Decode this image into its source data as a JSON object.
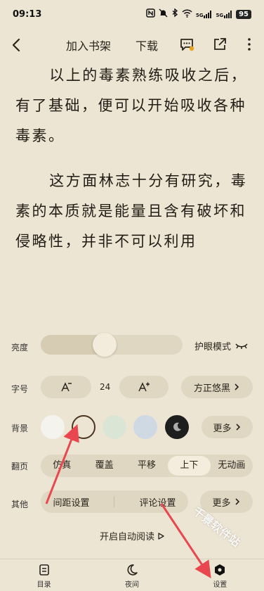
{
  "status_bar": {
    "time": "09:13",
    "signal_1": "5G",
    "signal_2": "5G",
    "battery": "95"
  },
  "toolbar": {
    "add_to_shelf": "加入书架",
    "download": "下载"
  },
  "reading": {
    "paragraphs": [
      "以上的毒素熟练吸收之后，有了基础，便可以开始吸收各种毒素。",
      "这方面林志十分有研究，毒素的本质就是能量且含有破坏和侵略性，并非不可以利用"
    ]
  },
  "settings": {
    "brightness_label": "亮度",
    "brightness_level": 0.45,
    "eye_care_label": "护眼模式",
    "font_size_label": "字号",
    "font_size_value": "24",
    "font_name": "方正悠黑",
    "background_label": "背景",
    "background_colors": [
      "#f5f3ee",
      "#ede5d3",
      "#dbe5d5",
      "#cfd9e3",
      "#1e1e1e"
    ],
    "background_more": "更多",
    "page_turn_label": "翻页",
    "page_turn_options": [
      "仿真",
      "覆盖",
      "平移",
      "上下",
      "无动画"
    ],
    "page_turn_selected": "上下",
    "other_label": "其他",
    "spacing_settings": "间距设置",
    "comment_settings": "评论设置",
    "other_more": "更多",
    "auto_read": "开启自动阅读"
  },
  "bottom_nav": {
    "items": [
      {
        "label": "目录"
      },
      {
        "label": "夜间"
      },
      {
        "label": "设置"
      }
    ]
  },
  "watermark": {
    "line_1": "千景软件站"
  },
  "colors": {
    "background": "#ede5d3",
    "pill": "#e0d7c3",
    "annotation_arrow": "#e8474f"
  }
}
